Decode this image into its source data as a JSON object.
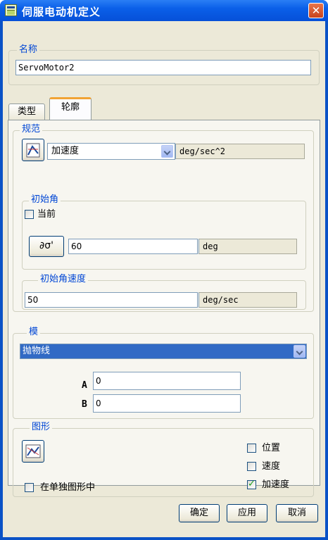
{
  "window": {
    "title": "伺服电动机定义"
  },
  "name_group": {
    "label": "名称",
    "value": "ServoMotor2"
  },
  "tabs": [
    {
      "label": "类型"
    },
    {
      "label": "轮廓"
    }
  ],
  "spec": {
    "label": "规范",
    "selected": "加速度",
    "unit": "deg/sec^2"
  },
  "initial_angle": {
    "label": "初始角",
    "current_label": "当前",
    "current_checked": false,
    "value": "60",
    "unit": "deg"
  },
  "initial_angular_velocity": {
    "label": "初始角速度",
    "value": "50",
    "unit": "deg/sec"
  },
  "model": {
    "label": "模",
    "selected": "抛物线",
    "a_label": "A",
    "a_value": "0",
    "b_label": "B",
    "b_value": "0"
  },
  "graph": {
    "label": "图形",
    "separate_label": "在单独图形中",
    "separate_checked": false,
    "position_label": "位置",
    "position_checked": false,
    "velocity_label": "速度",
    "velocity_checked": false,
    "acceleration_label": "加速度",
    "acceleration_checked": true
  },
  "buttons": {
    "ok": "确定",
    "apply": "应用",
    "cancel": "取消"
  },
  "colors": {
    "accent": "#0046d5",
    "titlebar": "#0a5fe8",
    "close": "#c9431c"
  }
}
